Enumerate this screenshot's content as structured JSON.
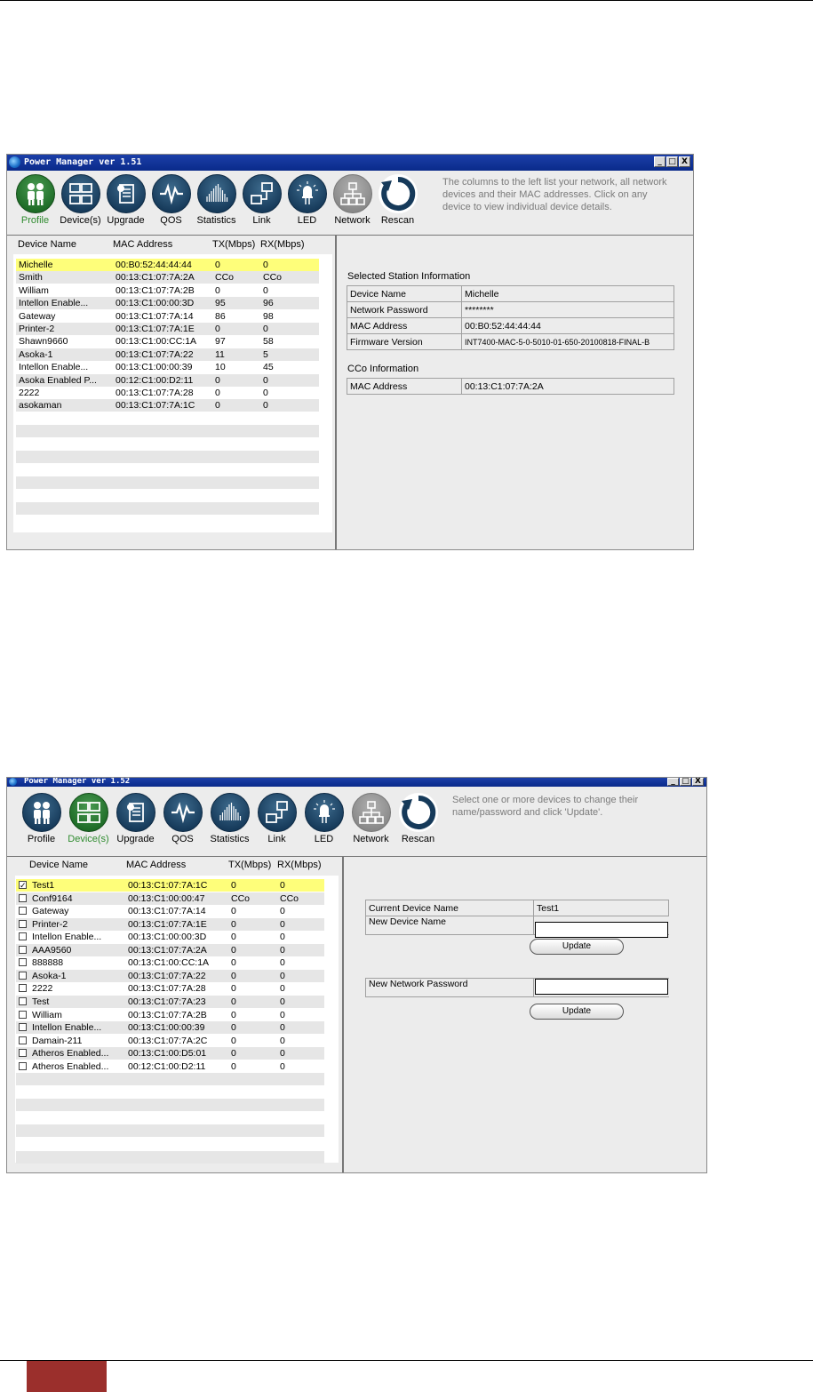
{
  "window1": {
    "title": "Power Manager ver 1.51",
    "minimize": "_",
    "maximize": "□",
    "close": "X",
    "toolbar": [
      "Profile",
      "Device(s)",
      "Upgrade",
      "QOS",
      "Statistics",
      "Link",
      "LED",
      "Network",
      "Rescan"
    ],
    "hint": [
      "The columns to the left list your network, all network",
      "devices and their MAC addresses. Click on any",
      "device to view individual device details."
    ],
    "headers": {
      "name": "Device Name",
      "mac": "MAC Address",
      "tx": "TX(Mbps)",
      "rx": "RX(Mbps)"
    },
    "rows": [
      {
        "name": "Michelle",
        "mac": "00:B0:52:44:44:44",
        "tx": "0",
        "rx": "0"
      },
      {
        "name": "Smith",
        "mac": "00:13:C1:07:7A:2A",
        "tx": "CCo",
        "rx": "CCo"
      },
      {
        "name": "William",
        "mac": "00:13:C1:07:7A:2B",
        "tx": "0",
        "rx": "0"
      },
      {
        "name": "Intellon Enable...",
        "mac": "00:13:C1:00:00:3D",
        "tx": "95",
        "rx": "96"
      },
      {
        "name": "Gateway",
        "mac": "00:13:C1:07:7A:14",
        "tx": "86",
        "rx": "98"
      },
      {
        "name": "Printer-2",
        "mac": "00:13:C1:07:7A:1E",
        "tx": "0",
        "rx": "0"
      },
      {
        "name": "Shawn9660",
        "mac": "00:13:C1:00:CC:1A",
        "tx": "97",
        "rx": "58"
      },
      {
        "name": "Asoka-1",
        "mac": "00:13:C1:07:7A:22",
        "tx": "11",
        "rx": "5"
      },
      {
        "name": "Intellon Enable...",
        "mac": "00:13:C1:00:00:39",
        "tx": "10",
        "rx": "45"
      },
      {
        "name": "Asoka Enabled P...",
        "mac": "00:12:C1:00:D2:11",
        "tx": "0",
        "rx": "0"
      },
      {
        "name": "2222",
        "mac": "00:13:C1:07:7A:28",
        "tx": "0",
        "rx": "0"
      },
      {
        "name": "asokaman",
        "mac": "00:13:C1:07:7A:1C",
        "tx": "0",
        "rx": "0"
      }
    ],
    "selected_station": {
      "heading": "Selected Station Information",
      "fields": [
        {
          "label": "Device Name",
          "value": "Michelle"
        },
        {
          "label": "Network Password",
          "value": "********"
        },
        {
          "label": "MAC Address",
          "value": "00:B0:52:44:44:44"
        },
        {
          "label": "Firmware Version",
          "value": "INT7400-MAC-5-0-5010-01-650-20100818-FINAL-B"
        }
      ]
    },
    "cco": {
      "heading": "CCo Information",
      "fields": [
        {
          "label": "MAC Address",
          "value": "00:13:C1:07:7A:2A"
        }
      ]
    }
  },
  "window2": {
    "title": "Power Manager ver 1.52",
    "minimize": "_",
    "maximize": "□",
    "close": "X",
    "toolbar": [
      "Profile",
      "Device(s)",
      "Upgrade",
      "QOS",
      "Statistics",
      "Link",
      "LED",
      "Network",
      "Rescan"
    ],
    "hint": [
      "Select one or more devices to change their",
      "name/password and click 'Update'."
    ],
    "headers": {
      "name": "Device Name",
      "mac": "MAC Address",
      "tx": "TX(Mbps)",
      "rx": "RX(Mbps)"
    },
    "rows": [
      {
        "name": "Test1",
        "mac": "00:13:C1:07:7A:1C",
        "tx": "0",
        "rx": "0",
        "checked": true
      },
      {
        "name": "Conf9164",
        "mac": "00:13:C1:00:00:47",
        "tx": "CCo",
        "rx": "CCo",
        "checked": false
      },
      {
        "name": "Gateway",
        "mac": "00:13:C1:07:7A:14",
        "tx": "0",
        "rx": "0",
        "checked": false
      },
      {
        "name": "Printer-2",
        "mac": "00:13:C1:07:7A:1E",
        "tx": "0",
        "rx": "0",
        "checked": false
      },
      {
        "name": "Intellon Enable...",
        "mac": "00:13:C1:00:00:3D",
        "tx": "0",
        "rx": "0",
        "checked": false
      },
      {
        "name": "AAA9560",
        "mac": "00:13:C1:07:7A:2A",
        "tx": "0",
        "rx": "0",
        "checked": false
      },
      {
        "name": "888888",
        "mac": "00:13:C1:00:CC:1A",
        "tx": "0",
        "rx": "0",
        "checked": false
      },
      {
        "name": "Asoka-1",
        "mac": "00:13:C1:07:7A:22",
        "tx": "0",
        "rx": "0",
        "checked": false
      },
      {
        "name": "2222",
        "mac": "00:13:C1:07:7A:28",
        "tx": "0",
        "rx": "0",
        "checked": false
      },
      {
        "name": "Test",
        "mac": "00:13:C1:07:7A:23",
        "tx": "0",
        "rx": "0",
        "checked": false
      },
      {
        "name": "William",
        "mac": "00:13:C1:07:7A:2B",
        "tx": "0",
        "rx": "0",
        "checked": false
      },
      {
        "name": "Intellon Enable...",
        "mac": "00:13:C1:00:00:39",
        "tx": "0",
        "rx": "0",
        "checked": false
      },
      {
        "name": "Damain-211",
        "mac": "00:13:C1:07:7A:2C",
        "tx": "0",
        "rx": "0",
        "checked": false
      },
      {
        "name": "Atheros Enabled...",
        "mac": "00:13:C1:00:D5:01",
        "tx": "0",
        "rx": "0",
        "checked": false
      },
      {
        "name": "Atheros Enabled...",
        "mac": "00:12:C1:00:D2:11",
        "tx": "0",
        "rx": "0",
        "checked": false
      }
    ],
    "current_device": {
      "label": "Current Device Name",
      "value": "Test1"
    },
    "new_device_name": {
      "label": "New Device Name",
      "value": ""
    },
    "new_password": {
      "label": "New Network Password",
      "value": ""
    },
    "update_label": "Update"
  }
}
